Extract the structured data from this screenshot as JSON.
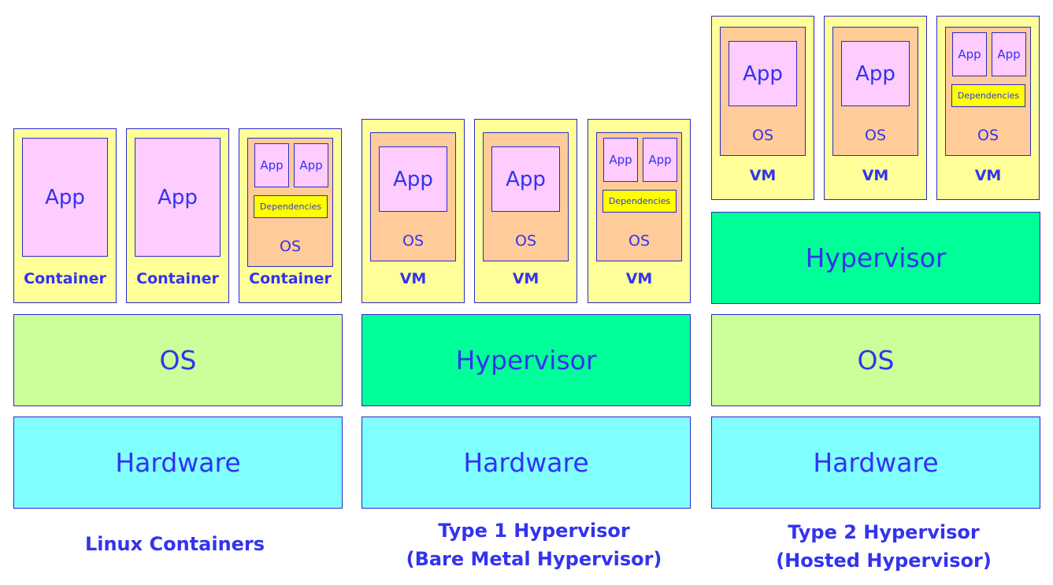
{
  "colors": {
    "unit": "#ffff99",
    "os_box": "#ffcc99",
    "app": "#ffccff",
    "dependencies": "#ffff00",
    "os_layer": "#ccff99",
    "hypervisor": "#00ff99",
    "hardware": "#80ffff",
    "text": "#3333ee",
    "border": "#2a2acc"
  },
  "stacks": [
    {
      "caption": [
        "Linux Containers"
      ],
      "layers": [
        "OS",
        "Hardware"
      ],
      "units": [
        {
          "label": "Container",
          "app": "App"
        },
        {
          "label": "Container",
          "app": "App"
        },
        {
          "label": "Container",
          "apps": [
            "App",
            "App"
          ],
          "dependencies": "Dependencies",
          "os": "OS"
        }
      ]
    },
    {
      "caption": [
        "Type 1 Hypervisor",
        "(Bare Metal Hypervisor)"
      ],
      "layers": [
        "Hypervisor",
        "Hardware"
      ],
      "units": [
        {
          "label": "VM",
          "app": "App",
          "os": "OS"
        },
        {
          "label": "VM",
          "app": "App",
          "os": "OS"
        },
        {
          "label": "VM",
          "apps": [
            "App",
            "App"
          ],
          "dependencies": "Dependencies",
          "os": "OS"
        }
      ]
    },
    {
      "caption": [
        "Type 2 Hypervisor",
        "(Hosted Hypervisor)"
      ],
      "layers": [
        "Hypervisor",
        "OS",
        "Hardware"
      ],
      "units": [
        {
          "label": "VM",
          "app": "App",
          "os": "OS"
        },
        {
          "label": "VM",
          "app": "App",
          "os": "OS"
        },
        {
          "label": "VM",
          "apps": [
            "App",
            "App"
          ],
          "dependencies": "Dependencies",
          "os": "OS"
        }
      ]
    }
  ]
}
